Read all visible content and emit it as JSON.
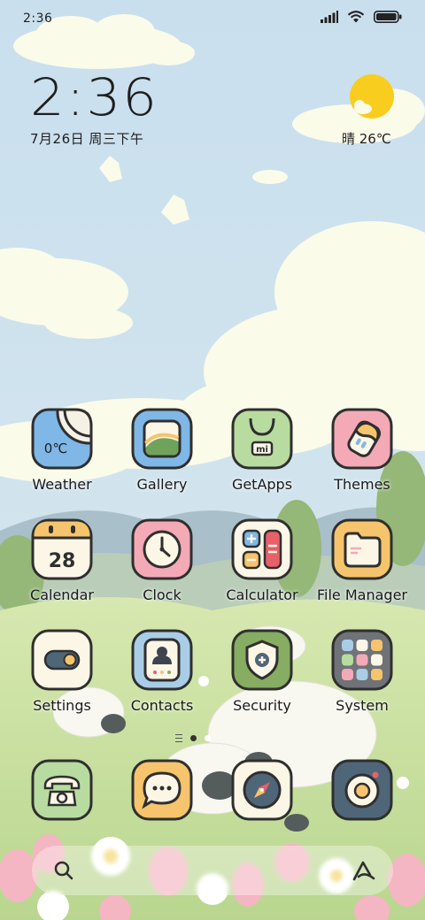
{
  "status_bar": {
    "time": "2:36",
    "icons": [
      "signal-icon",
      "wifi-icon",
      "battery-icon"
    ]
  },
  "clock_widget": {
    "time": "2:36",
    "date": "7月26日 周三下午"
  },
  "weather_widget": {
    "icon": "sun-cloud-icon",
    "text": "晴 26℃"
  },
  "apps": [
    {
      "label": "Weather",
      "icon": "weather-icon",
      "icon_text": "0℃",
      "bg": "#7fb7e6"
    },
    {
      "label": "Gallery",
      "icon": "gallery-icon",
      "bg": "#7fb7e6"
    },
    {
      "label": "GetApps",
      "icon": "shopping-bag-icon",
      "icon_text": "mi",
      "bg": "#b8dca0"
    },
    {
      "label": "Themes",
      "icon": "themes-icon",
      "bg": "#f4a9b6"
    },
    {
      "label": "Calendar",
      "icon": "calendar-icon",
      "icon_text": "28",
      "bg": "#fbf6e6"
    },
    {
      "label": "Clock",
      "icon": "clock-icon",
      "bg": "#f4a9b6"
    },
    {
      "label": "Calculator",
      "icon": "calculator-icon",
      "bg": "#fbf6e6"
    },
    {
      "label": "File Manager",
      "icon": "folder-icon",
      "bg": "#f5c46c"
    },
    {
      "label": "Settings",
      "icon": "toggle-icon",
      "bg": "#fbf6e6"
    },
    {
      "label": "Contacts",
      "icon": "contacts-icon",
      "bg": "#a9cde6"
    },
    {
      "label": "Security",
      "icon": "shield-icon",
      "bg": "#86ad62"
    },
    {
      "label": "System",
      "icon": "folder-grid-icon",
      "bg": "#6f7377"
    }
  ],
  "dock": [
    {
      "name": "phone",
      "icon": "phone-icon",
      "bg": "#b8dca0"
    },
    {
      "name": "messages",
      "icon": "message-icon",
      "bg": "#f5c46c"
    },
    {
      "name": "browser",
      "icon": "compass-icon",
      "bg": "#fbf6e6"
    },
    {
      "name": "camera",
      "icon": "camera-icon",
      "bg": "#4f6678"
    }
  ],
  "page_indicator": {
    "pages": 2,
    "active": 1
  },
  "search_bar": {
    "left_icon": "search-icon",
    "right_icon": "assistant-icon"
  },
  "colors": {
    "sky": "#cfe3ee",
    "cloud": "#fbfbea",
    "grass": "#c6de9e",
    "outline": "#2f2f2f"
  }
}
